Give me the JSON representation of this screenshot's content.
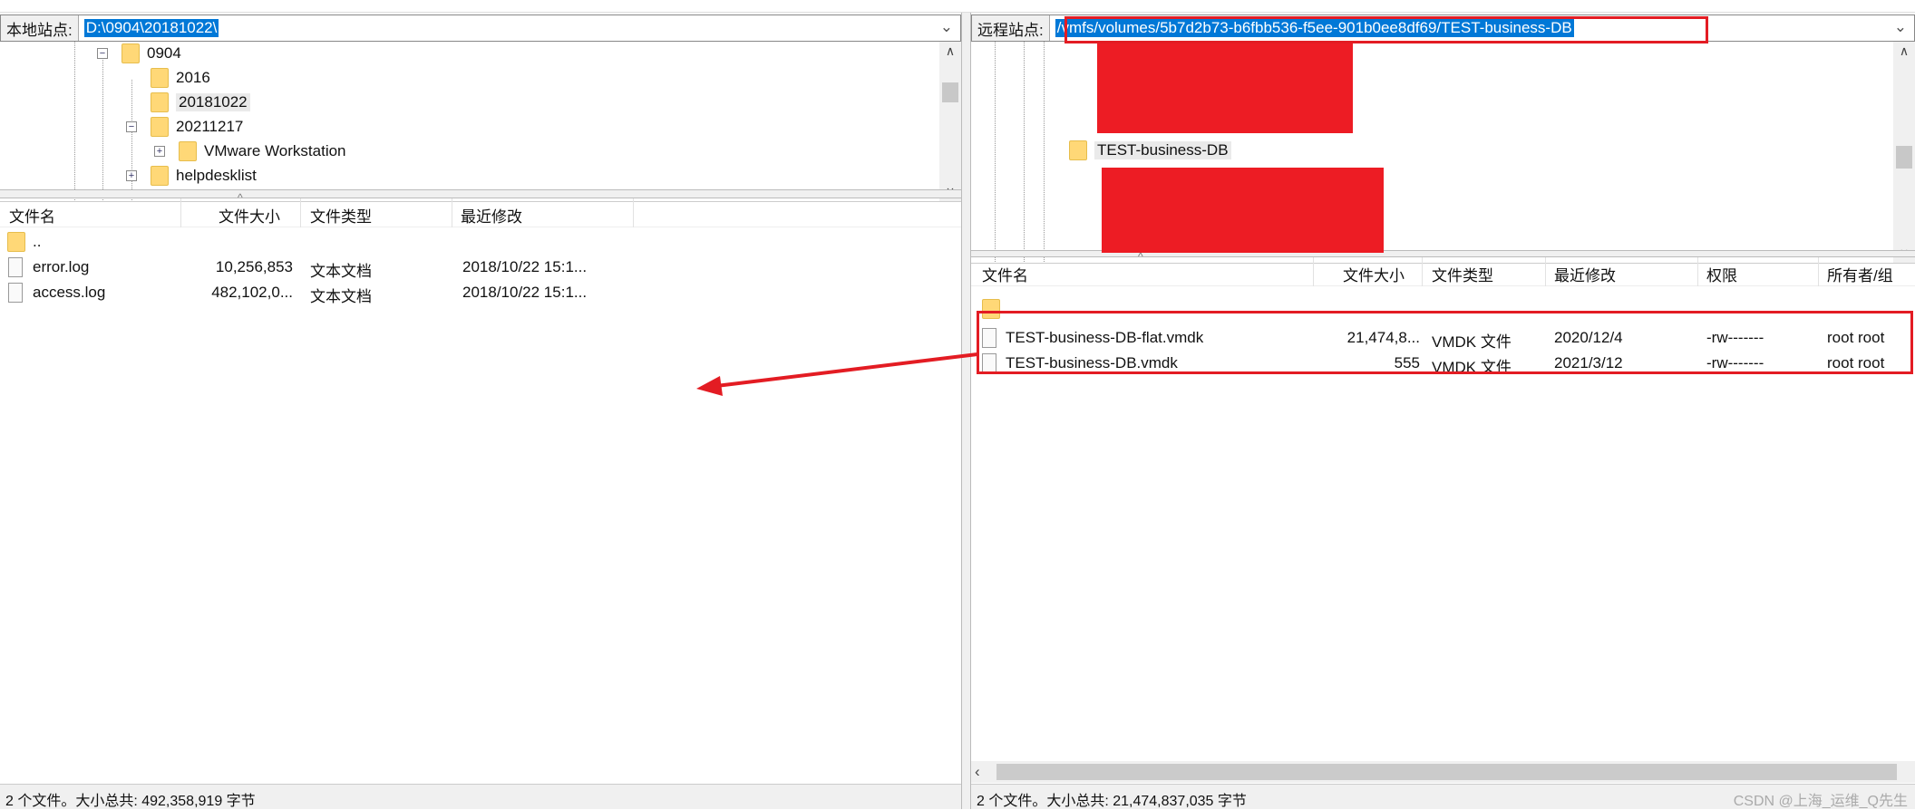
{
  "local": {
    "site_label": "本地站点:",
    "path": "D:\\0904\\20181022\\",
    "tree": [
      {
        "name": "0904",
        "expander": "minus"
      },
      {
        "name": "2016",
        "expander": ""
      },
      {
        "name": "20181022",
        "expander": "",
        "selected": true
      },
      {
        "name": "20211217",
        "expander": "minus"
      },
      {
        "name": "VMware Workstation",
        "expander": "plus"
      },
      {
        "name": "helpdesklist",
        "expander": "plus"
      }
    ],
    "columns": [
      "文件名",
      "文件大小",
      "文件类型",
      "最近修改"
    ],
    "files": [
      {
        "name": "..",
        "size": "",
        "type": "",
        "modified": "",
        "icon": "folder-icon"
      },
      {
        "name": "error.log",
        "size": "10,256,853",
        "type": "文本文档",
        "modified": "2018/10/22 15:1...",
        "icon": "file-icon"
      },
      {
        "name": "access.log",
        "size": "482,102,0...",
        "type": "文本文档",
        "modified": "2018/10/22 15:1...",
        "icon": "file-icon"
      }
    ],
    "status": "2 个文件。大小总共: 492,358,919 字节"
  },
  "remote": {
    "site_label": "远程站点:",
    "path": "/vmfs/volumes/5b7d2b73-b6fbb536-f5ee-901b0ee8df69/TEST-business-DB",
    "tree": [
      {
        "name": "TEST-business-DB",
        "selected": true
      }
    ],
    "columns": [
      "文件名",
      "文件大小",
      "文件类型",
      "最近修改",
      "权限",
      "所有者/组"
    ],
    "files": [
      {
        "name": "..",
        "size": "",
        "type": "",
        "modified": "",
        "perm": "",
        "owner": "",
        "icon": "folder-icon"
      },
      {
        "name": "TEST-business-DB-flat.vmdk",
        "size": "21,474,8...",
        "type": "VMDK 文件",
        "modified": "2020/12/4",
        "perm": "-rw-------",
        "owner": "root root",
        "icon": "file-icon"
      },
      {
        "name": "TEST-business-DB.vmdk",
        "size": "555",
        "type": "VMDK 文件",
        "modified": "2021/3/12",
        "perm": "-rw-------",
        "owner": "root root",
        "icon": "file-icon"
      }
    ],
    "status": "2 个文件。大小总共: 21,474,837,035 字节"
  },
  "watermark": "CSDN @上海_运维_Q先生",
  "colors": {
    "selection": "#0078d7",
    "annotation_red": "#e31c23",
    "folder": "#ffd877"
  }
}
